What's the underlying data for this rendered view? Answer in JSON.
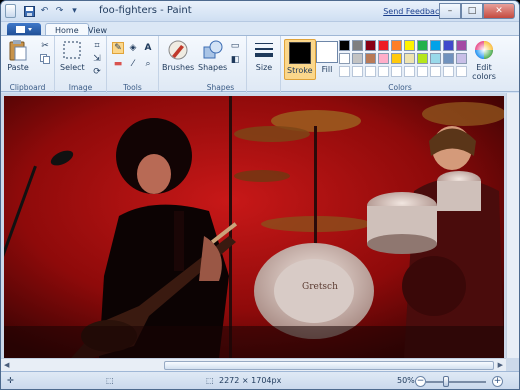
{
  "window": {
    "title": "foo-fighters - Paint",
    "send_feedback": "Send Feedback",
    "controls": [
      "–",
      "□",
      "✕"
    ]
  },
  "quick_access": [
    "💾",
    "↶",
    "↷",
    "▾"
  ],
  "tabs": {
    "home": "Home",
    "view": "View"
  },
  "ribbon": {
    "clipboard": {
      "label": "Clipboard",
      "paste": "Paste"
    },
    "image": {
      "label": "Image",
      "select": "Select"
    },
    "tools": {
      "label": "Tools"
    },
    "brushes": {
      "label": "Brushes"
    },
    "shapes": {
      "label": "Shapes",
      "button": "Shapes"
    },
    "size": {
      "label": "Size"
    },
    "stroke": {
      "label": "Stroke"
    },
    "fill": {
      "label": "Fill"
    },
    "colors": {
      "label": "Colors",
      "edit": "Edit colors"
    }
  },
  "palette_row1": [
    "#000000",
    "#7f7f7f",
    "#880015",
    "#ed1c24",
    "#ff7f27",
    "#fff200",
    "#22b14c",
    "#00a2e8",
    "#3f48cc",
    "#a349a4"
  ],
  "palette_row2": [
    "#ffffff",
    "#c3c3c3",
    "#b97a57",
    "#ffaec9",
    "#ffc90e",
    "#efe4b0",
    "#b5e61d",
    "#99d9ea",
    "#7092be",
    "#c8bfe7"
  ],
  "statusbar": {
    "dimensions": "2272 × 1704px",
    "zoom": "50%"
  }
}
